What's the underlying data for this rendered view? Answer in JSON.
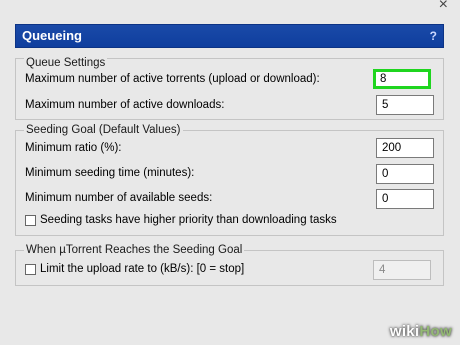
{
  "window": {
    "close_glyph": "×",
    "header_title": "Queueing",
    "help_glyph": "?"
  },
  "queue_settings": {
    "legend": "Queue Settings",
    "max_active_torrents_label": "Maximum number of active torrents (upload or download):",
    "max_active_torrents_value": "8",
    "max_active_downloads_label": "Maximum number of active downloads:",
    "max_active_downloads_value": "5"
  },
  "seeding_goal": {
    "legend": "Seeding Goal (Default Values)",
    "min_ratio_label": "Minimum ratio (%):",
    "min_ratio_value": "200",
    "min_seeding_time_label": "Minimum seeding time (minutes):",
    "min_seeding_time_value": "0",
    "min_available_seeds_label": "Minimum number of available seeds:",
    "min_available_seeds_value": "0",
    "priority_checkbox_label": "Seeding tasks have higher priority than downloading tasks",
    "priority_checked": false
  },
  "reaches_goal": {
    "legend": "When µTorrent Reaches the Seeding Goal",
    "limit_upload_label": "Limit the upload rate to (kB/s): [0 = stop]",
    "limit_upload_checked": false,
    "limit_upload_value": "4"
  },
  "watermark": {
    "wiki": "wiki",
    "how": "How"
  }
}
